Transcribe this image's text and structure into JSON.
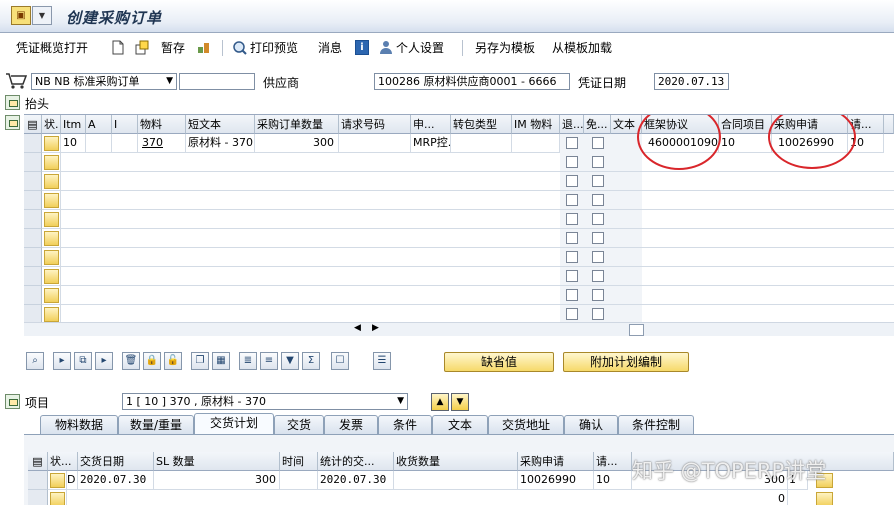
{
  "app": {
    "title": "创建采购订单"
  },
  "toolbar": {
    "preview": "凭证概览打开",
    "hold": "暂存",
    "print": "打印预览",
    "messages": "消息",
    "personal": "个人设置",
    "save_template": "另存为模板",
    "load_template": "从模板加载"
  },
  "header": {
    "doc_type": "NB NB 标准采购订单",
    "vendor_label": "供应商",
    "vendor_value": "100286 原材料供应商0001 - 6666",
    "date_label": "凭证日期",
    "date_value": "2020.07.13",
    "section": "抬头"
  },
  "items_table": {
    "columns": [
      "状.",
      "Itm",
      "A",
      "I",
      "物料",
      "短文本",
      "采购订单数量",
      "请求号码",
      "申...",
      "转包类型",
      "IM 物料",
      "退...",
      "免...",
      "文本",
      "框架协议",
      "合同项目",
      "采购申请",
      "请..."
    ],
    "row": {
      "itm": "10",
      "material": "370",
      "short_text": "原材料 - 370",
      "qty": "300",
      "apply": "MRP控...",
      "agreement": "4600001090",
      "contract_item": "10",
      "requisition": "10026990",
      "req_item": "10"
    }
  },
  "buttons": {
    "default_values": "缺省值",
    "add_planning": "附加计划编制"
  },
  "item_section": {
    "label": "项目",
    "selected": "1 [ 10 ] 370 , 原材料 - 370"
  },
  "tabs": [
    "物料数据",
    "数量/重量",
    "交货计划",
    "交货",
    "发票",
    "条件",
    "文本",
    "交货地址",
    "确认",
    "条件控制"
  ],
  "active_tab": "交货计划",
  "schedule_table": {
    "columns": [
      "状...",
      "交货日期",
      "SL 数量",
      "时间",
      "统计的交...",
      "收货数量",
      "采购申请",
      "请..."
    ],
    "row": {
      "status": "D",
      "date": "2020.07.30",
      "qty": "300",
      "stat_date": "2020.07.30",
      "requisition": "10026990",
      "req_item": "10",
      "right_value": "300",
      "right_value_2": "0",
      "right_flag": "1"
    }
  },
  "watermark": "知乎 @TOPERP讲堂"
}
